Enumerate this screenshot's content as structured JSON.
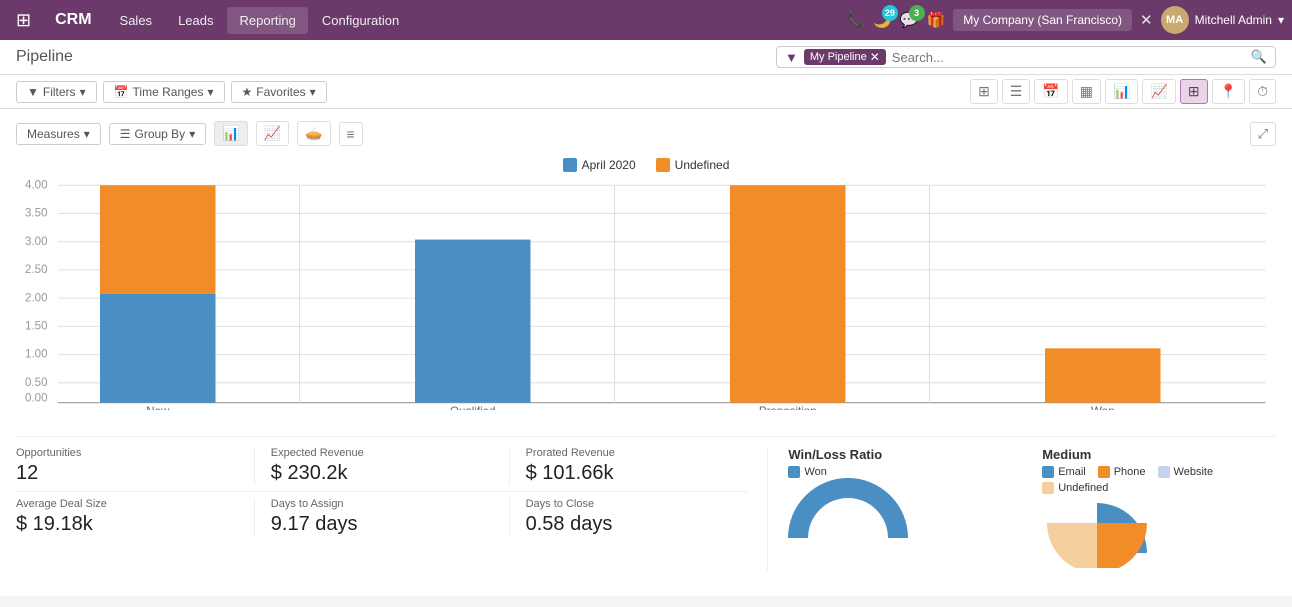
{
  "topnav": {
    "brand": "CRM",
    "menu": [
      "Sales",
      "Leads",
      "Reporting",
      "Configuration"
    ],
    "active_menu": "Reporting",
    "badge_29": "29",
    "badge_3": "3",
    "company": "My Company (San Francisco)",
    "user": "Mitchell Admin"
  },
  "secondbar": {
    "page_title": "Pipeline",
    "filter_label": "My Pipeline",
    "search_placeholder": "Search..."
  },
  "toolbar": {
    "filters_label": "Filters",
    "timeranges_label": "Time Ranges",
    "favorites_label": "Favorites"
  },
  "chart_toolbar": {
    "measures_label": "Measures",
    "groupby_label": "Group By"
  },
  "chart": {
    "legend": [
      {
        "label": "April 2020",
        "color": "#4a8fc4"
      },
      {
        "label": "Undefined",
        "color": "#f28c28"
      }
    ],
    "yaxis": [
      "4.00",
      "3.50",
      "3.00",
      "2.50",
      "2.00",
      "1.50",
      "1.00",
      "0.50",
      "0.00"
    ],
    "bars": [
      {
        "label": "New",
        "blue": 2.0,
        "orange": 2.0
      },
      {
        "label": "Qualified",
        "blue": 3.0,
        "orange": 0.0
      },
      {
        "label": "Proposition",
        "blue": 0.0,
        "orange": 4.0
      },
      {
        "label": "Won",
        "blue": 0.0,
        "orange": 1.0
      }
    ]
  },
  "stats": {
    "opportunities": {
      "label": "Opportunities",
      "value": "12"
    },
    "expected_revenue": {
      "label": "Expected Revenue",
      "value": "$ 230.2k"
    },
    "prorated_revenue": {
      "label": "Prorated Revenue",
      "value": "$ 101.66k"
    },
    "avg_deal_size": {
      "label": "Average Deal Size",
      "value": "$ 19.18k"
    },
    "days_to_assign": {
      "label": "Days to Assign",
      "value": "9.17 days"
    },
    "days_to_close": {
      "label": "Days to Close",
      "value": "0.58 days"
    }
  },
  "win_loss": {
    "title": "Win/Loss Ratio",
    "legend": [
      {
        "label": "Won",
        "color": "#4a8fc4"
      }
    ]
  },
  "medium": {
    "title": "Medium",
    "legend": [
      {
        "label": "Email",
        "color": "#4a8fc4"
      },
      {
        "label": "Phone",
        "color": "#f28c28"
      },
      {
        "label": "Website",
        "color": "#c5d4e8"
      },
      {
        "label": "Undefined",
        "color": "#f5d09e"
      }
    ]
  }
}
